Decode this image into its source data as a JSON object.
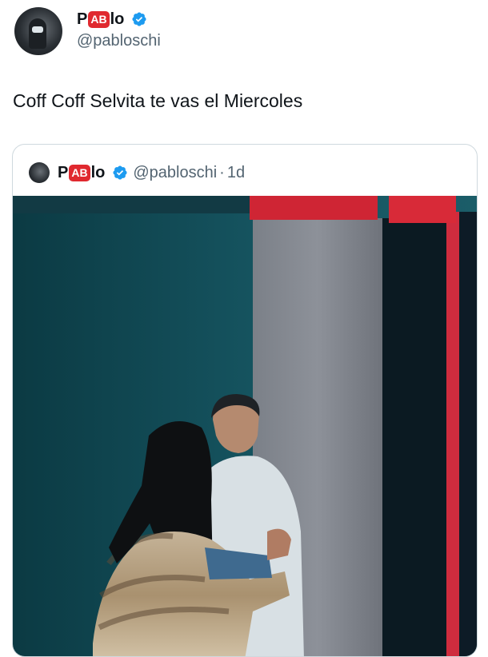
{
  "author": {
    "name_prefix": "P",
    "name_badge": "AB",
    "name_suffix": "lo",
    "apple_glyph": "",
    "handle": "@pabloschi",
    "verified_color": "#1d9bf0",
    "badge_color": "#e0292f"
  },
  "tweet": {
    "text": "Coff Coff Selvita te vas el Miercoles"
  },
  "quoted_tweet": {
    "name_prefix": "P",
    "name_badge": "AB",
    "name_suffix": "lo",
    "apple_glyph": "",
    "handle": "@pabloschi",
    "separator": "·",
    "time": "1d"
  },
  "icons": {
    "verified": "verified-badge-icon",
    "apple": "apple-icon"
  }
}
